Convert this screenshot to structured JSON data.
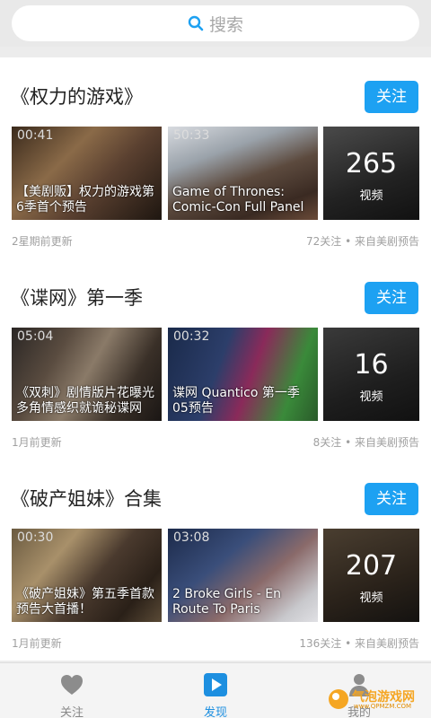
{
  "search": {
    "placeholder": "搜索"
  },
  "sections": [
    {
      "title": "《权力的游戏》",
      "follow_label": "关注",
      "videos": [
        {
          "duration": "00:41",
          "caption": "【美剧贩】权力的游戏第6季首个预告"
        },
        {
          "duration": "50:33",
          "caption": "Game of Thrones: Comic-Con Full Panel"
        }
      ],
      "total_count": "265",
      "count_label": "视频",
      "updated": "2星期前更新",
      "stats": "72关注 • 来自美剧预告"
    },
    {
      "title": "《谍网》第一季",
      "follow_label": "关注",
      "videos": [
        {
          "duration": "05:04",
          "caption": "《双刺》剧情版片花曝光 多角情感织就诡秘谍网"
        },
        {
          "duration": "00:32",
          "caption": "谍网 Quantico 第一季05预告"
        }
      ],
      "total_count": "16",
      "count_label": "视频",
      "updated": "1月前更新",
      "stats": "8关注 • 来自美剧预告"
    },
    {
      "title": "《破产姐妹》合集",
      "follow_label": "关注",
      "videos": [
        {
          "duration": "00:30",
          "caption": "《破产姐妹》第五季首款预告大首播！"
        },
        {
          "duration": "03:08",
          "caption": "2 Broke Girls - En Route To Paris"
        }
      ],
      "total_count": "207",
      "count_label": "视频",
      "updated": "1月前更新",
      "stats": "136关注 • 来自美剧预告"
    }
  ],
  "tabs": [
    {
      "label": "关注",
      "icon": "heart-icon"
    },
    {
      "label": "发现",
      "icon": "play-icon"
    },
    {
      "label": "我的",
      "icon": "person-icon"
    }
  ],
  "watermark": {
    "text": "气泡游戏网",
    "sub": "www.QPMZM.COM"
  },
  "colors": {
    "accent": "#1da1f2",
    "tab_active": "#1d8fe0"
  }
}
